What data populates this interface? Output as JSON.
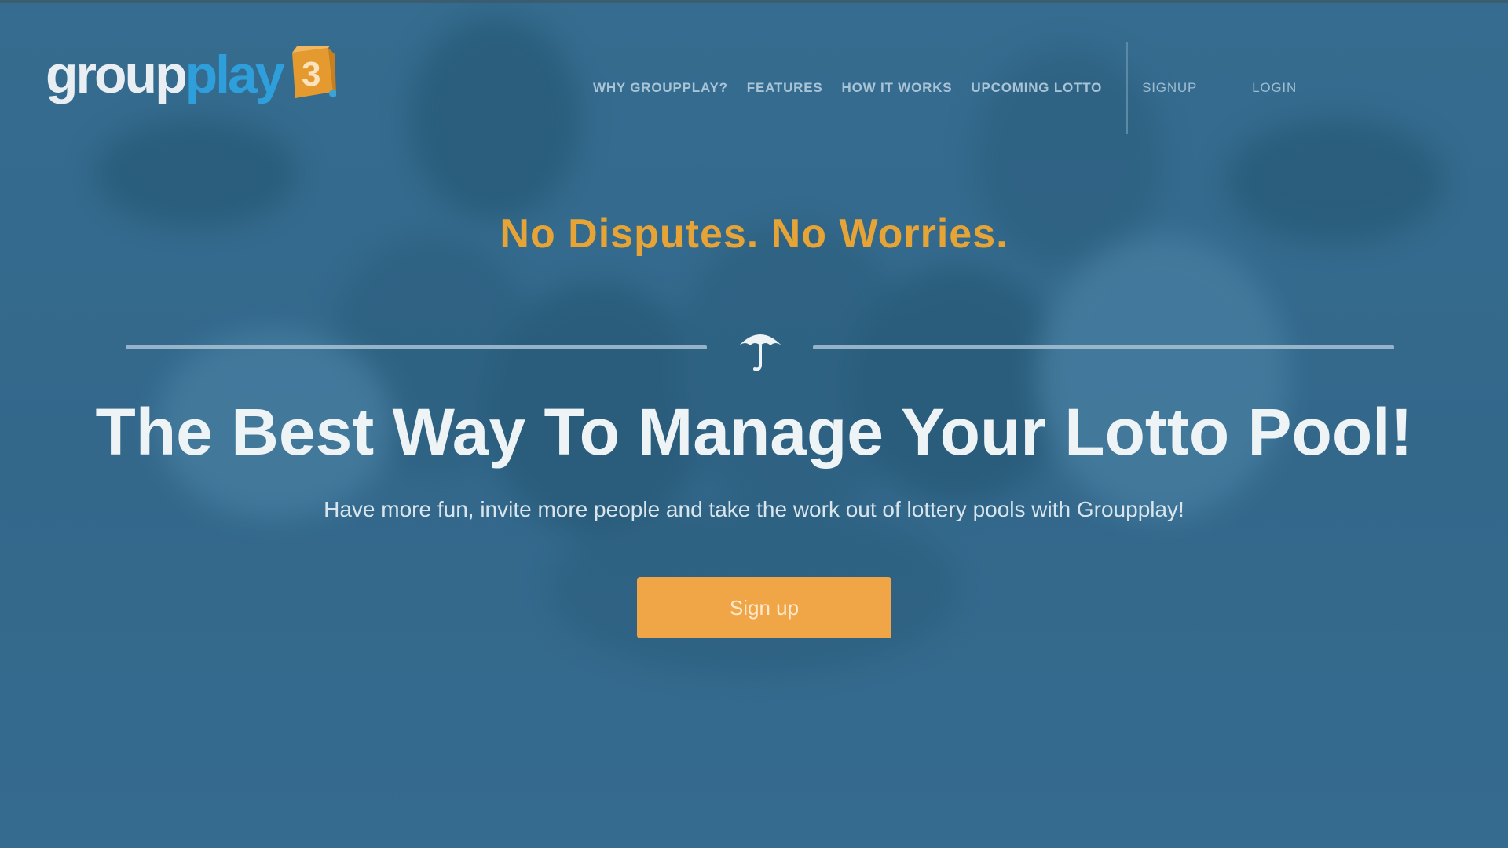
{
  "brand": {
    "part1": "group",
    "part2": "play",
    "colors": {
      "group": "#e9eef2",
      "play": "#2f9fdc",
      "accent": "#f0a546"
    }
  },
  "nav": {
    "items": [
      {
        "label": "Why Groupplay?"
      },
      {
        "label": "Features"
      },
      {
        "label": "How It Works"
      },
      {
        "label": "Upcoming Lotto"
      }
    ],
    "signup_label": "Signup",
    "login_label": "Login"
  },
  "hero": {
    "tagline": "No Disputes. No Worries.",
    "divider_icon": "umbrella-icon",
    "headline": "The Best Way To Manage Your Lotto Pool!",
    "subline": "Have more fun, invite more people and take the work out of lottery pools with Groupplay!",
    "cta_label": "Sign up",
    "colors": {
      "background": "#33688b",
      "tagline": "#e6a437",
      "cta": "#f0a546"
    }
  }
}
